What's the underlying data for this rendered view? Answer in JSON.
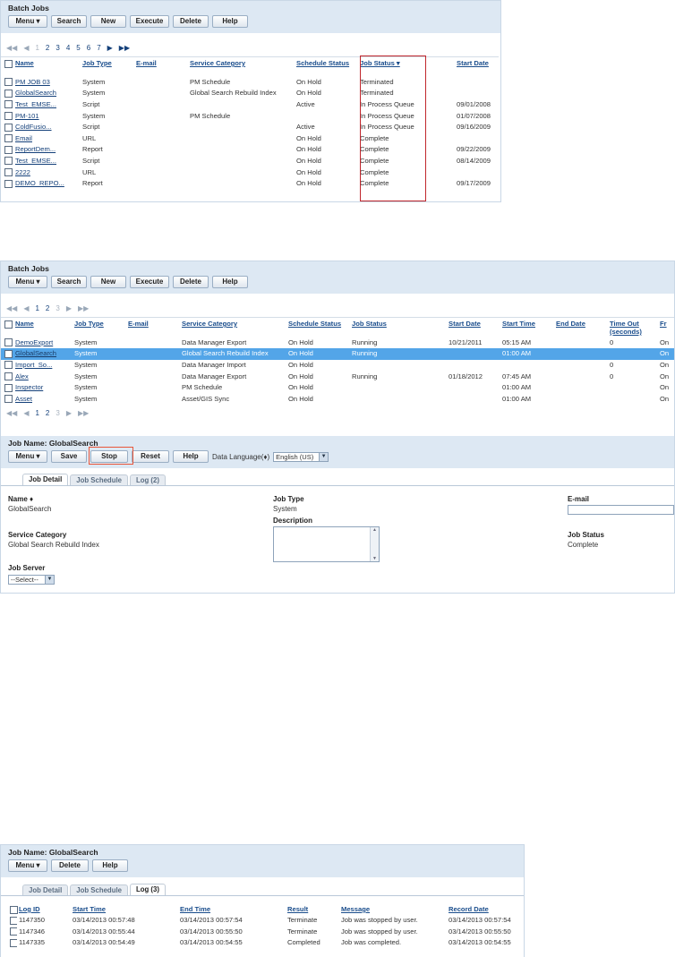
{
  "panel1": {
    "title": "Batch Jobs",
    "toolbar": [
      "Menu ▾",
      "Search",
      "New",
      "Execute",
      "Delete",
      "Help"
    ],
    "pager": {
      "first": "◀◀",
      "prev": "◀",
      "pages": [
        "1",
        "2",
        "3",
        "4",
        "5",
        "6",
        "7"
      ],
      "next": "▶",
      "last": "▶▶"
    },
    "columns": [
      "Name",
      "Job Type",
      "E-mail",
      "Service Category",
      "Schedule Status",
      "Job Status ▾",
      "Start Date"
    ],
    "rows": [
      [
        "PM JOB 03",
        "System",
        "",
        "PM Schedule",
        "On Hold",
        "Terminated",
        ""
      ],
      [
        "GlobalSearch",
        "System",
        "",
        "Global Search Rebuild Index",
        "On Hold",
        "Terminated",
        ""
      ],
      [
        "Test_EMSE...",
        "Script",
        "",
        "",
        "Active",
        "In Process Queue",
        "09/01/2008"
      ],
      [
        "PM-101",
        "System",
        "",
        "PM Schedule",
        "",
        "In Process Queue",
        "01/07/2008"
      ],
      [
        "ColdFusio...",
        "Script",
        "",
        "",
        "Active",
        "In Process Queue",
        "09/16/2009"
      ],
      [
        "Email",
        "URL",
        "",
        "",
        "On Hold",
        "Complete",
        ""
      ],
      [
        "ReportDem...",
        "Report",
        "",
        "",
        "On Hold",
        "Complete",
        "09/22/2009"
      ],
      [
        "Test_EMSE...",
        "Script",
        "",
        "",
        "On Hold",
        "Complete",
        "08/14/2009"
      ],
      [
        "2222",
        "URL",
        "",
        "",
        "On Hold",
        "Complete",
        ""
      ],
      [
        "DEMO_REPO...",
        "Report",
        "",
        "",
        "On Hold",
        "Complete",
        "09/17/2009"
      ]
    ]
  },
  "panel2": {
    "title": "Batch Jobs",
    "toolbar": [
      "Menu ▾",
      "Search",
      "New",
      "Execute",
      "Delete",
      "Help"
    ],
    "pager": {
      "first": "◀◀",
      "prev": "◀",
      "pages": [
        "1",
        "2",
        "3"
      ],
      "next": "▶",
      "last": "▶▶"
    },
    "columns": [
      "Name",
      "Job Type",
      "E-mail",
      "Service Category",
      "Schedule Status",
      "Job Status",
      "Start Date",
      "Start Time",
      "End Date",
      "Time Out (seconds)",
      "Fr"
    ],
    "rows": [
      [
        "DemoExport",
        "System",
        "",
        "Data Manager Export",
        "On Hold",
        "Running",
        "10/21/2011",
        "05:15 AM",
        "",
        "0",
        "On"
      ],
      [
        "GlobalSearch",
        "System",
        "",
        "Global Search Rebuild Index",
        "On Hold",
        "Running",
        "",
        "01:00 AM",
        "",
        "",
        "On"
      ],
      [
        "Import_So...",
        "System",
        "",
        "Data Manager Import",
        "On Hold",
        "",
        "",
        "",
        "",
        "0",
        "On"
      ],
      [
        "Alex",
        "System",
        "",
        "Data Manager Export",
        "On Hold",
        "Running",
        "01/18/2012",
        "07:45 AM",
        "",
        "0",
        "On"
      ],
      [
        "Inspector",
        "System",
        "",
        "PM Schedule",
        "On Hold",
        "",
        "",
        "01:00 AM",
        "",
        "",
        "On"
      ],
      [
        "Asset",
        "System",
        "",
        "Asset/GIS Sync",
        "On Hold",
        "",
        "",
        "01:00 AM",
        "",
        "",
        "On"
      ]
    ],
    "detail": {
      "title": "Job Name: GlobalSearch",
      "toolbar": [
        "Menu ▾",
        "Save",
        "Stop",
        "Reset",
        "Help"
      ],
      "data_language_label": "Data Language(♦)",
      "data_language_value": "English (US)",
      "tabs": [
        "Job Detail",
        "Job Schedule",
        "Log (2)"
      ],
      "name_label": "Name ♦",
      "name_value": "GlobalSearch",
      "job_type_label": "Job Type",
      "job_type_value": "System",
      "email_label": "E-mail",
      "description_label": "Description",
      "service_category_label": "Service Category",
      "service_category_value": "Global Search Rebuild Index",
      "job_status_label": "Job Status",
      "job_status_value": "Complete",
      "job_server_label": "Job Server",
      "job_server_value": "--Select--"
    }
  },
  "panel3": {
    "title": "Job Name: GlobalSearch",
    "toolbar": [
      "Menu ▾",
      "Delete",
      "Help"
    ],
    "tabs": [
      "Job Detail",
      "Job Schedule",
      "Log (3)"
    ],
    "columns": [
      "Log ID",
      "Start Time",
      "End Time",
      "Result",
      "Message",
      "Record Date"
    ],
    "rows": [
      [
        "1147350",
        "03/14/2013 00:57:48",
        "03/14/2013 00:57:54",
        "Terminate",
        "Job was stopped by user.",
        "03/14/2013 00:57:54"
      ],
      [
        "1147346",
        "03/14/2013 00:55:44",
        "03/14/2013 00:55:50",
        "Terminate",
        "Job was stopped by user.",
        "03/14/2013 00:55:50"
      ],
      [
        "1147335",
        "03/14/2013 00:54:49",
        "03/14/2013 00:54:55",
        "Completed",
        "Job was completed.",
        "03/14/2013 00:54:55"
      ]
    ]
  }
}
